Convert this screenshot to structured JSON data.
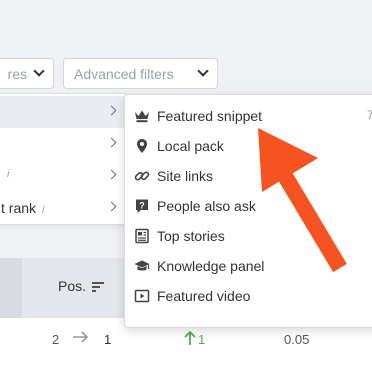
{
  "top_bar": {
    "partial_select_label": "res",
    "advanced_filters_label": "Advanced filters"
  },
  "left_menu": {
    "items": [
      {
        "label": ""
      },
      {
        "label": ""
      },
      {
        "label": "i"
      },
      {
        "label": "t rank",
        "info": "i"
      }
    ]
  },
  "dropdown": {
    "items": [
      {
        "label": "Featured snippet",
        "icon": "crown-icon",
        "count": "7"
      },
      {
        "label": "Local pack",
        "icon": "map-pin-icon"
      },
      {
        "label": "Site links",
        "icon": "link-icon"
      },
      {
        "label": "People also ask",
        "icon": "question-icon"
      },
      {
        "label": "Top stories",
        "icon": "newspaper-icon"
      },
      {
        "label": "Knowledge panel",
        "icon": "graduation-cap-icon"
      },
      {
        "label": "Featured video",
        "icon": "video-icon"
      }
    ]
  },
  "table": {
    "pos_header": "Pos.",
    "row": {
      "prev_pos": "2",
      "pos": "1",
      "change": "1",
      "value": "0.05"
    }
  },
  "colors": {
    "annotation_arrow": "#f5531f",
    "up_arrow": "#4caf50",
    "background": "#f0f1f5"
  }
}
